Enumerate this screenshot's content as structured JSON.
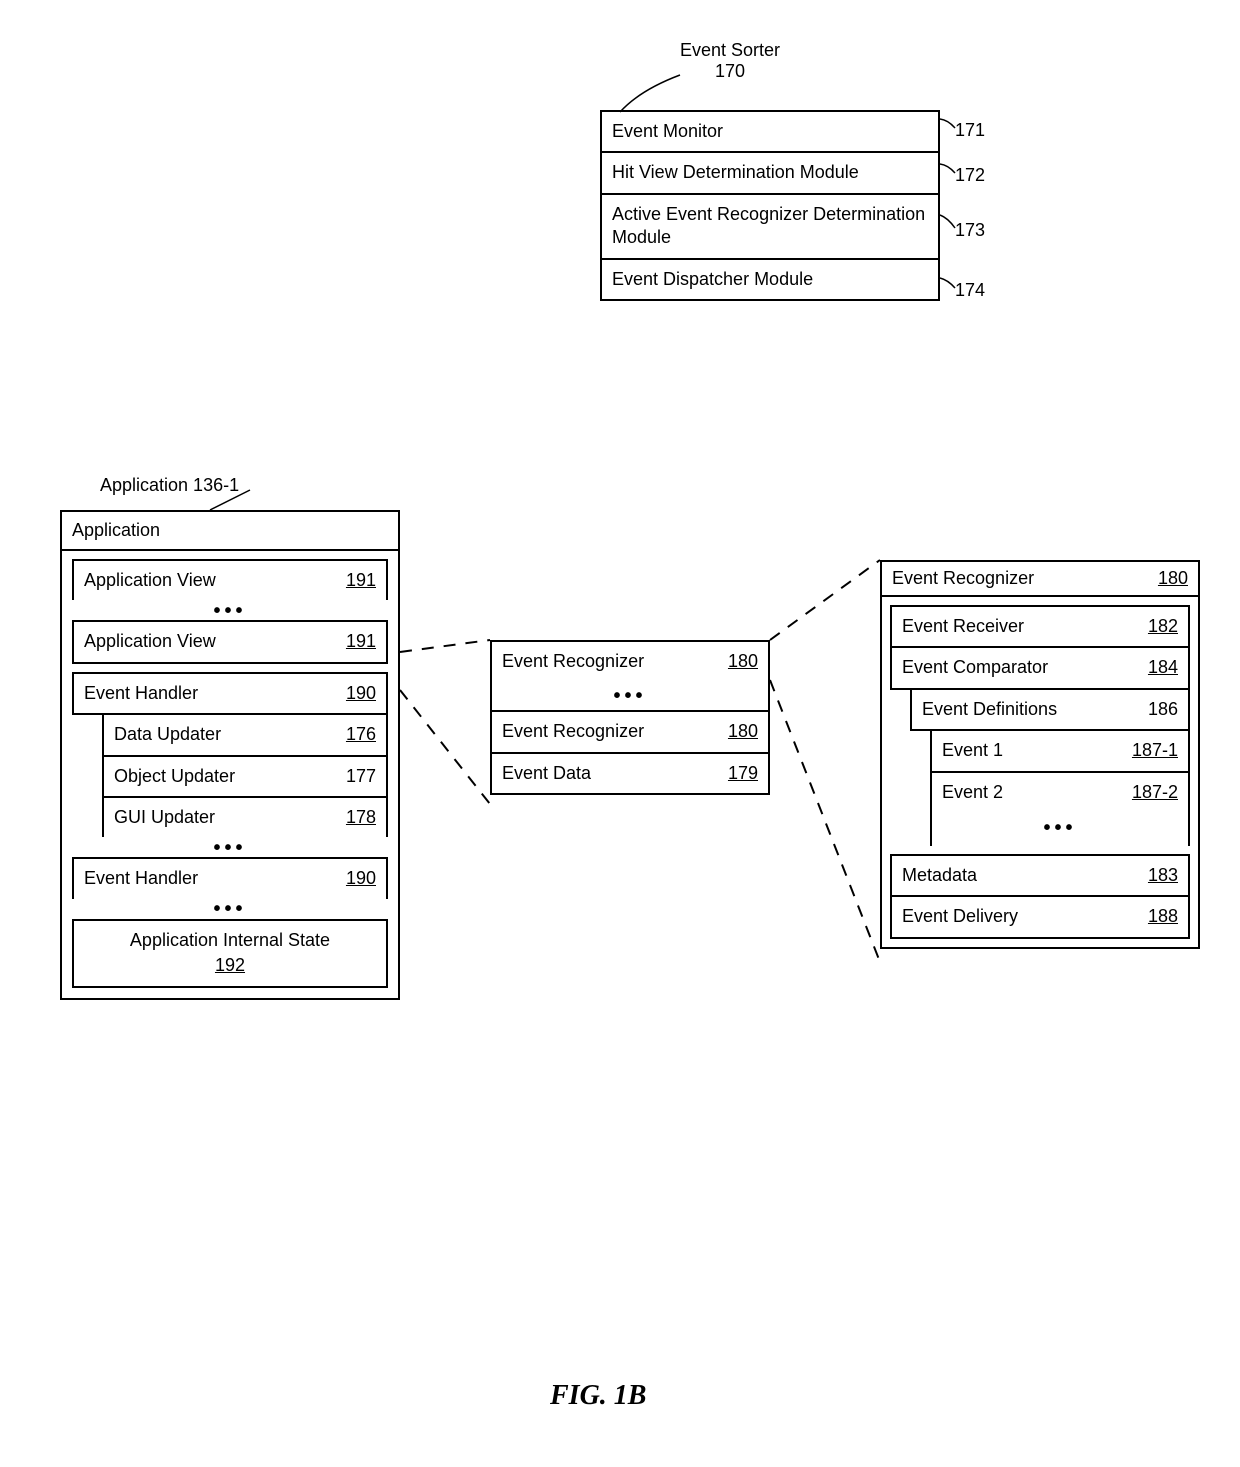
{
  "figure_label": "FIG. 1B",
  "event_sorter": {
    "title": "Event Sorter",
    "ref": "170",
    "rows": [
      {
        "label": "Event Monitor",
        "ref": "171"
      },
      {
        "label": "Hit View Determination Module",
        "ref": "172"
      },
      {
        "label": "Active Event Recognizer Determination Module",
        "ref": "173"
      },
      {
        "label": "Event Dispatcher Module",
        "ref": "174"
      }
    ]
  },
  "application": {
    "ext_label": "Application 136-1",
    "header": "Application",
    "views": {
      "label": "Application View",
      "ref": "191"
    },
    "event_handler": {
      "label": "Event Handler",
      "ref": "190",
      "sub": [
        {
          "label": "Data Updater",
          "ref": "176"
        },
        {
          "label": "Object Updater",
          "ref": "177"
        },
        {
          "label": "GUI Updater",
          "ref": "178"
        }
      ]
    },
    "internal_state": {
      "label": "Application Internal State",
      "ref": "192"
    }
  },
  "view_detail": {
    "rows": [
      {
        "label": "Event Recognizer",
        "ref": "180"
      },
      {
        "label": "Event Recognizer",
        "ref": "180"
      },
      {
        "label": "Event Data",
        "ref": "179"
      }
    ]
  },
  "event_recognizer": {
    "title": "Event Recognizer",
    "ref": "180",
    "rows": [
      {
        "label": "Event Receiver",
        "ref": "182"
      },
      {
        "label": "Event Comparator",
        "ref": "184"
      }
    ],
    "definitions": {
      "label": "Event Definitions",
      "ref": "186",
      "items": [
        {
          "label": "Event 1",
          "ref": "187-1"
        },
        {
          "label": "Event 2",
          "ref": "187-2"
        }
      ]
    },
    "tail": [
      {
        "label": "Metadata",
        "ref": "183"
      },
      {
        "label": "Event Delivery",
        "ref": "188"
      }
    ]
  }
}
